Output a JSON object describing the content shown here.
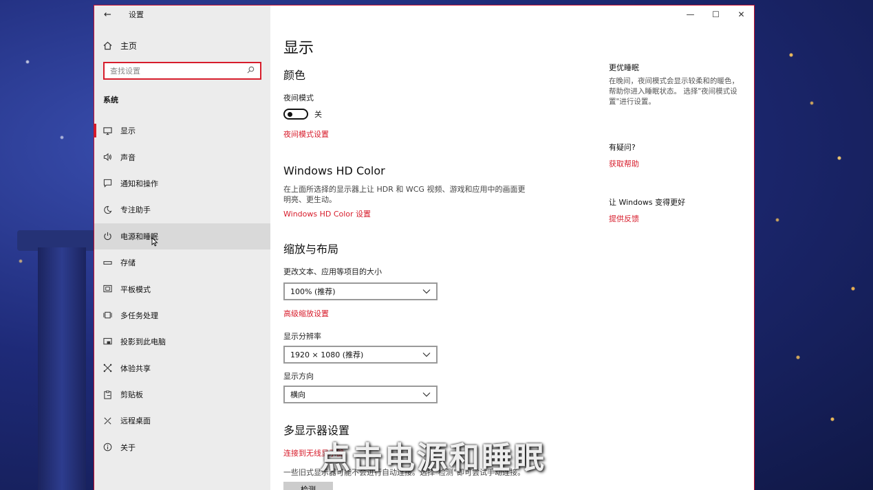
{
  "window": {
    "title": "设置"
  },
  "sidebar": {
    "home_label": "主页",
    "search_placeholder": "查找设置",
    "group_label": "系统",
    "items": [
      {
        "label": "显示",
        "icon": "monitor-icon",
        "active": true
      },
      {
        "label": "声音",
        "icon": "speaker-icon"
      },
      {
        "label": "通知和操作",
        "icon": "notification-icon"
      },
      {
        "label": "专注助手",
        "icon": "moon-icon"
      },
      {
        "label": "电源和睡眠",
        "icon": "power-icon",
        "hover": true
      },
      {
        "label": "存储",
        "icon": "storage-icon"
      },
      {
        "label": "平板模式",
        "icon": "tablet-icon"
      },
      {
        "label": "多任务处理",
        "icon": "multitask-icon"
      },
      {
        "label": "投影到此电脑",
        "icon": "project-icon"
      },
      {
        "label": "体验共享",
        "icon": "share-icon"
      },
      {
        "label": "剪贴板",
        "icon": "clipboard-icon"
      },
      {
        "label": "远程桌面",
        "icon": "remote-desktop-icon"
      },
      {
        "label": "关于",
        "icon": "info-icon"
      }
    ]
  },
  "main": {
    "page_title": "显示",
    "color": {
      "title": "颜色",
      "night_mode_label": "夜间模式",
      "toggle_state": "关",
      "night_mode_link": "夜间模式设置"
    },
    "hdr": {
      "title": "Windows HD Color",
      "desc": "在上面所选择的显示器上让 HDR 和 WCG 视频、游戏和应用中的画面更明亮、更生动。",
      "link": "Windows HD Color 设置"
    },
    "scale": {
      "title": "缩放与布局",
      "size_label": "更改文本、应用等项目的大小",
      "size_value": "100% (推荐)",
      "advanced_link": "高级缩放设置",
      "resolution_label": "显示分辨率",
      "resolution_value": "1920 × 1080 (推荐)",
      "orientation_label": "显示方向",
      "orientation_value": "横向"
    },
    "multi": {
      "title": "多显示器设置",
      "wireless_link": "连接到无线显示器",
      "desc": "一些旧式显示器可能不会进行自动连接。选择\"检测\"即可尝试手动连接。",
      "detect_label": "检测"
    }
  },
  "aside": {
    "sleep_title": "更优睡眠",
    "sleep_text": "在晚间，夜间模式会显示较柔和的暖色，帮助你进入睡眠状态。 选择\"夜间模式设置\"进行设置。",
    "question_title": "有疑问?",
    "help_link": "获取帮助",
    "improve_title": "让 Windows 变得更好",
    "feedback_link": "提供反馈"
  },
  "caption": "点击电源和睡眠",
  "colors": {
    "accent": "#d71c2b",
    "sidebar_bg": "#ececec"
  }
}
